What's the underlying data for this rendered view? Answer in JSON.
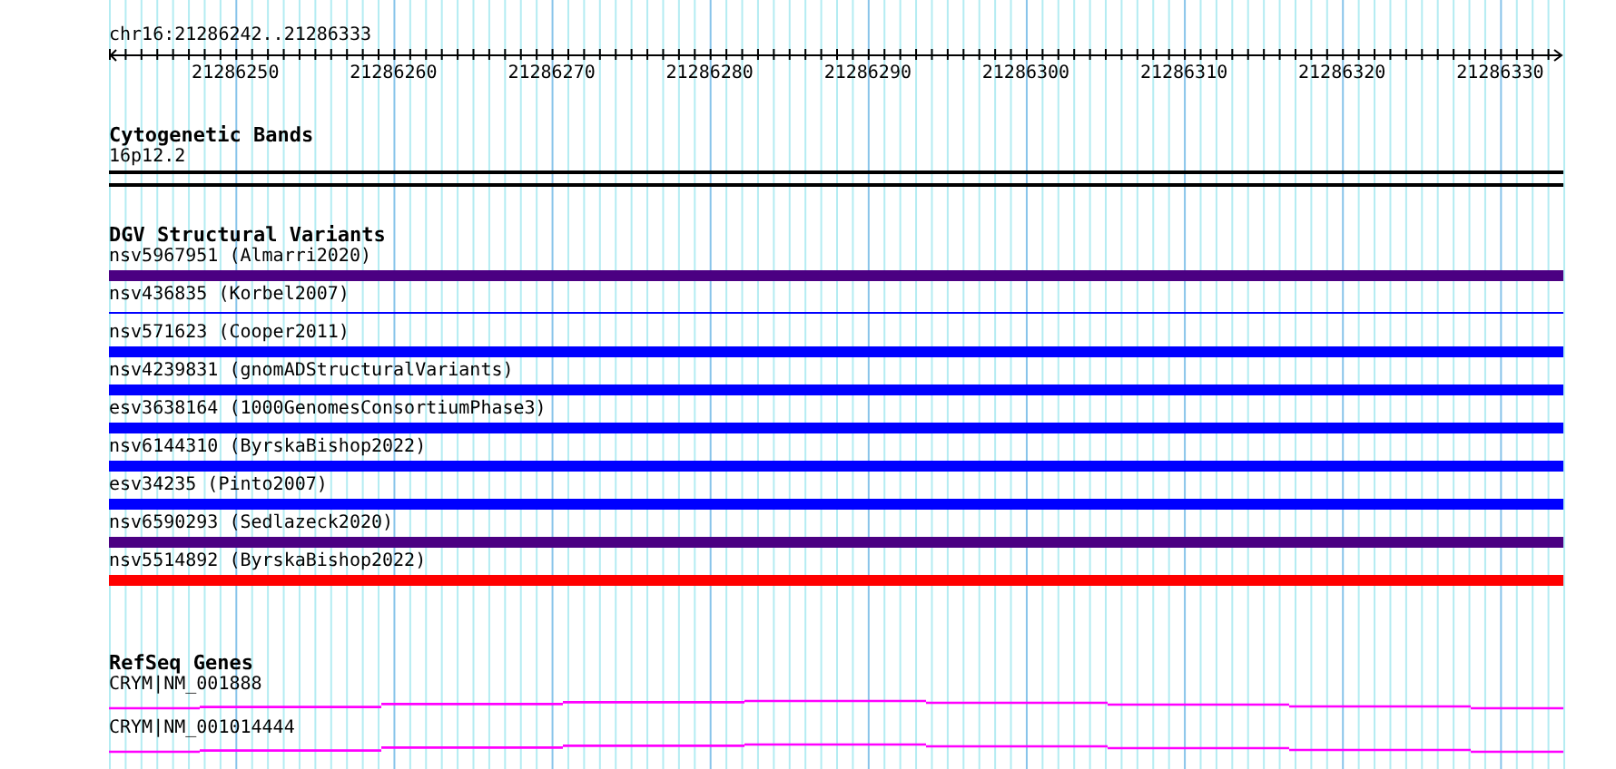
{
  "ruler": {
    "position": "chr16:21286242..21286333",
    "ticks": [
      "21286250",
      "21286260",
      "21286270",
      "21286280",
      "21286290",
      "21286300",
      "21286310",
      "21286320",
      "21286330"
    ]
  },
  "tracks": [
    {
      "kind": "bands",
      "title": "Cytogenetic Bands",
      "items": [
        {
          "label": "16p12.2"
        }
      ]
    },
    {
      "kind": "variants",
      "title": "DGV Structural Variants",
      "items": [
        {
          "label": "nsv5967951 (Almarri2020)",
          "color": "#4b0082",
          "kind": "thick"
        },
        {
          "label": "nsv436835 (Korbel2007)",
          "color": "#0000ff",
          "kind": "thin"
        },
        {
          "label": "nsv571623 (Cooper2011)",
          "color": "#0000ff",
          "kind": "thick"
        },
        {
          "label": "nsv4239831 (gnomADStructuralVariants)",
          "color": "#0000ff",
          "kind": "thick"
        },
        {
          "label": "esv3638164 (1000GenomesConsortiumPhase3)",
          "color": "#0000ff",
          "kind": "thick"
        },
        {
          "label": "nsv6144310 (ByrskaBishop2022)",
          "color": "#0000ff",
          "kind": "thick"
        },
        {
          "label": "esv34235 (Pinto2007)",
          "color": "#0000ff",
          "kind": "thick"
        },
        {
          "label": "nsv6590293 (Sedlazeck2020)",
          "color": "#4b0082",
          "kind": "thick"
        },
        {
          "label": "nsv5514892 (ByrskaBishop2022)",
          "color": "#ff0000",
          "kind": "thick"
        }
      ]
    },
    {
      "kind": "genes",
      "title": "RefSeq Genes",
      "items": [
        {
          "label": "CRYM|NM_001888"
        },
        {
          "label": "CRYM|NM_001014444"
        }
      ]
    }
  ]
}
